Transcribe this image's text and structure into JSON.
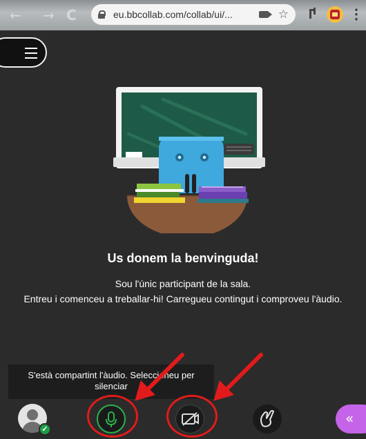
{
  "browser": {
    "back_icon": "←",
    "forward_icon": "→",
    "reload_icon": "C",
    "url": "eu.bbcollab.com/collab/ui/...",
    "star_icon": "☆",
    "kebab": "⋮"
  },
  "welcome": {
    "title": "Us donem la benvinguda!",
    "line1": "Sou l'únic participant de la sala.",
    "line2": "Entreu i comenceu a treballar-hi! Carregueu contingut i comproveu l'àudio."
  },
  "tooltip": {
    "text": "S'està compartint l'àudio. Seleccioneu per silenciar"
  },
  "controls": {
    "status_check": "✓",
    "collapse_icon": "«"
  },
  "colors": {
    "background": "#2b2b2b",
    "mic_active": "#2bb24c",
    "annotation_red": "#e11b1b",
    "collapse_purple": "#c564e8"
  }
}
